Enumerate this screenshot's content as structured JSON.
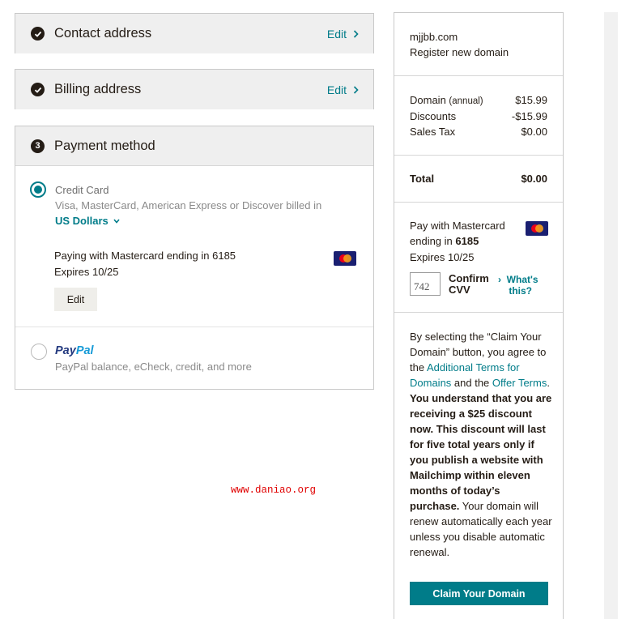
{
  "contact": {
    "title": "Contact address",
    "edit_label": "Edit"
  },
  "billing": {
    "title": "Billing address",
    "edit_label": "Edit"
  },
  "payment": {
    "step_number": "3",
    "title": "Payment method",
    "credit_card": {
      "label": "Credit Card",
      "description": "Visa, MasterCard, American Express or Discover billed in",
      "currency": "US Dollars",
      "paying_prefix": "Paying with Mastercard ending in ",
      "last4": "6185",
      "expires_prefix": "Expires ",
      "expiry": "10/25",
      "edit_label": "Edit",
      "selected": true
    },
    "paypal": {
      "logo_pay": "Pay",
      "logo_pal": "Pal",
      "description": "PayPal balance, eCheck, credit, and more",
      "selected": false
    }
  },
  "watermark": "www.daniao.org",
  "summary": {
    "domain": "mjjbb.com",
    "subtitle": "Register new domain",
    "lines": [
      {
        "label": "Domain",
        "note": "(annual)",
        "amount": "$15.99"
      },
      {
        "label": "Discounts",
        "note": "",
        "amount": "-$15.99"
      },
      {
        "label": "Sales Tax",
        "note": "",
        "amount": "$0.00"
      }
    ],
    "total_label": "Total",
    "total_amount": "$0.00",
    "pay_with": {
      "line1": "Pay with Mastercard",
      "line2_prefix": "ending in ",
      "last4": "6185",
      "expires": "Expires 10/25"
    },
    "cvv": {
      "value": "742",
      "label_line1": "Confirm",
      "label_line2": "CVV",
      "whats_this_line1": "What's",
      "whats_this_line2": "this?"
    },
    "legal": {
      "p1": "By selecting the “Claim Your Domain” button, you agree to the ",
      "link1": "Additional Terms for Domains",
      "p2": " and the ",
      "link2": "Offer Terms",
      "p3": ". ",
      "bold": "You understand that you are receiving a $25 discount now. This discount will last for five total years only if you publish a website with Mailchimp within eleven months of today’s purchase.",
      "p4": " Your domain will renew automatically each year unless you disable automatic renewal."
    },
    "claim_button": "Claim Your Domain"
  },
  "colors": {
    "accent": "#007c89",
    "dark": "#241c15",
    "header_bg": "#efefef",
    "watermark": "#e00000"
  },
  "icons": [
    "check-circle-icon",
    "chevron-right-icon",
    "chevron-down-icon",
    "mastercard-icon"
  ]
}
